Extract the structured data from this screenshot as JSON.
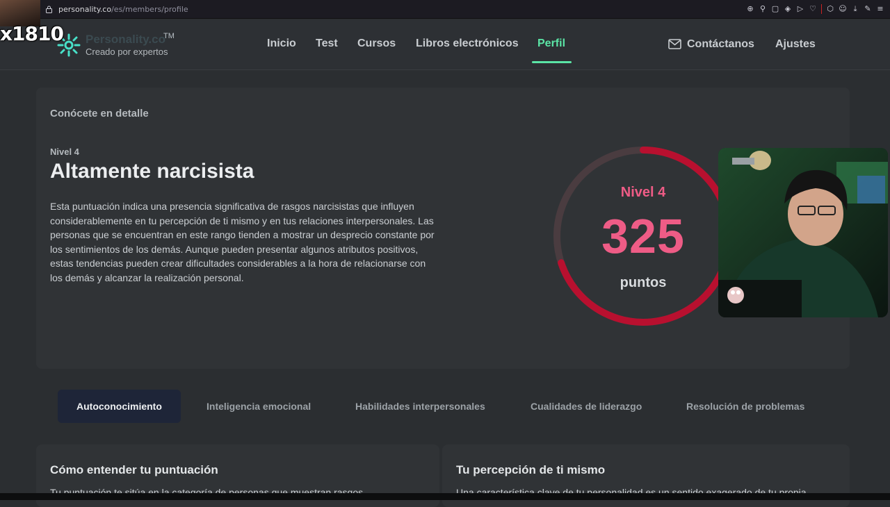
{
  "browser": {
    "url_host": "personality.co",
    "url_path": "/es/members/profile"
  },
  "overlay": {
    "handle": "x1810"
  },
  "brand": {
    "name": "Personality.co",
    "tm": "TM",
    "tagline": "Creado por expertos",
    "accent": "#5be5a6"
  },
  "nav": {
    "items": [
      {
        "label": "Inicio"
      },
      {
        "label": "Test"
      },
      {
        "label": "Cursos"
      },
      {
        "label": "Libros electrónicos"
      },
      {
        "label": "Perfil",
        "active": true
      }
    ],
    "contact": "Contáctanos",
    "settings": "Ajustes"
  },
  "hero": {
    "eyebrow": "Conócete en detalle",
    "level": "Nivel 4",
    "headline": "Altamente narcisista",
    "description": "Esta puntuación indica una presencia significativa de rasgos narcisistas que influyen considerablemente en tu percepción de ti mismo y en tus relaciones interpersonales. Las personas que se encuentran en este rango tienden a mostrar un desprecio constante por los sentimientos de los demás. Aunque pueden presentar algunos atributos positivos, estas tendencias pueden crear dificultades considerables a la hora de relacionarse con los demás y alcanzar la realización personal."
  },
  "gauge": {
    "level": "Nivel 4",
    "score": "325",
    "unit": "puntos",
    "fill_fraction": 0.7,
    "color": "#b8102f"
  },
  "tabs": [
    {
      "label": "Autoconocimiento",
      "active": true
    },
    {
      "label": "Inteligencia emocional"
    },
    {
      "label": "Habilidades interpersonales"
    },
    {
      "label": "Cualidades de liderazgo"
    },
    {
      "label": "Resolución de problemas"
    }
  ],
  "sections": [
    {
      "title": "Cómo entender tu puntuación",
      "text": "Tu puntuación te sitúa en la categoría de personas que muestran rasgos"
    },
    {
      "title": "Tu percepción de ti mismo",
      "text": "Una característica clave de tu personalidad es un sentido exagerado de tu propia"
    }
  ]
}
